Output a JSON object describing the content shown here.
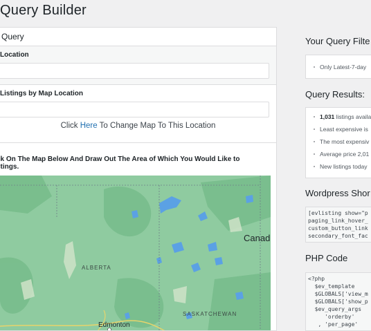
{
  "page": {
    "title": "Query Builder"
  },
  "panel": {
    "header": "Query",
    "location_label": "Location",
    "location_value": "",
    "listings_label": "Listings by Map Location",
    "listings_value": "",
    "change_prefix": "Click",
    "change_link": "Here",
    "change_suffix": "To Change Map To This Location",
    "map_instructions": "ck On The Map Below And Draw Out The Area of Which You Would Like to stings."
  },
  "map": {
    "labels": {
      "canada": "Canad",
      "alberta": "ALBERTA",
      "saskatchewan": "SASKATCHEWAN",
      "edmonton": "Edmonton"
    },
    "colors": {
      "land": "#8fcba0",
      "land_dark": "#74b98a",
      "water": "#5aa0e6",
      "light": "#cfe3c8"
    }
  },
  "sidebar": {
    "filters_title": "Your Query Filte",
    "filters": [
      "Only Latest-7-day"
    ],
    "results_title": "Query Results:",
    "results": [
      {
        "bold": "1,031",
        "text": " listings availa"
      },
      {
        "bold": "",
        "text": "Least expensive is"
      },
      {
        "bold": "",
        "text": "The most expensiv"
      },
      {
        "bold": "",
        "text": "Average price 2,01"
      },
      {
        "bold": "",
        "text": "New listings today"
      }
    ],
    "shortcode_title": "Wordpress Shor",
    "shortcode": "[evlisting show=\"p\npaging_link_hover_\ncustom_button_link\nsecondary_font_fac",
    "php_title": "PHP Code",
    "php": "<?php\n  $ev_template\n  $GLOBALS['view_m\n  $GLOBALS['show_p\n  $ev_query_args\n     'orderby'\n   , 'per_page'"
  }
}
